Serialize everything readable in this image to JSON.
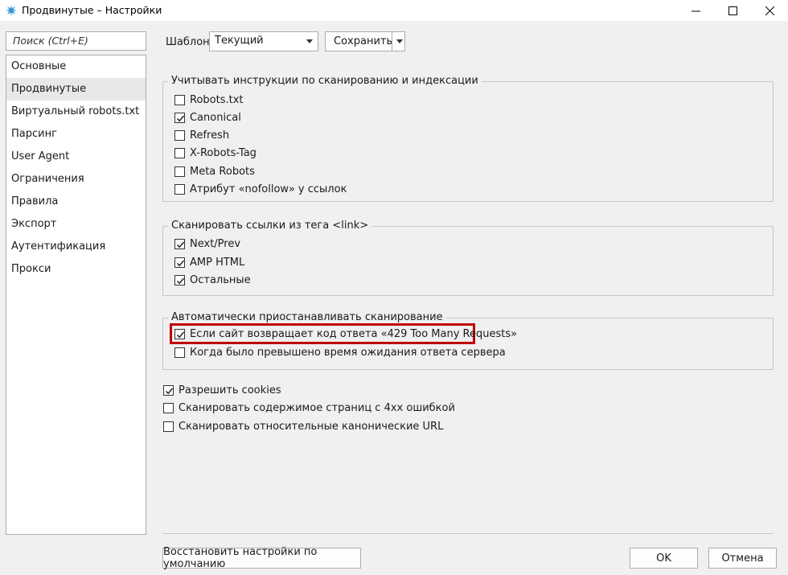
{
  "window": {
    "title": "Продвинутые – Настройки"
  },
  "sidebar": {
    "search_placeholder": "Поиск (Ctrl+E)",
    "items": [
      {
        "label": "Основные",
        "active": false
      },
      {
        "label": "Продвинутые",
        "active": true
      },
      {
        "label": "Виртуальный robots.txt",
        "active": false
      },
      {
        "label": "Парсинг",
        "active": false
      },
      {
        "label": "User Agent",
        "active": false
      },
      {
        "label": "Ограничения",
        "active": false
      },
      {
        "label": "Правила",
        "active": false
      },
      {
        "label": "Экспорт",
        "active": false
      },
      {
        "label": "Аутентификация",
        "active": false
      },
      {
        "label": "Прокси",
        "active": false
      }
    ]
  },
  "toolbar": {
    "template_label": "Шаблон:",
    "template_value": "Текущий",
    "save_label": "Сохранить"
  },
  "groups": {
    "indexing": {
      "title": "Учитывать инструкции по сканированию и индексации",
      "items": [
        {
          "label": "Robots.txt",
          "checked": false
        },
        {
          "label": "Canonical",
          "checked": true
        },
        {
          "label": "Refresh",
          "checked": false
        },
        {
          "label": "X-Robots-Tag",
          "checked": false
        },
        {
          "label": "Meta Robots",
          "checked": false
        },
        {
          "label": "Атрибут «nofollow» у ссылок",
          "checked": false
        }
      ]
    },
    "link_tag": {
      "title": "Сканировать ссылки из тега <link>",
      "items": [
        {
          "label": "Next/Prev",
          "checked": true
        },
        {
          "label": "AMP HTML",
          "checked": true
        },
        {
          "label": "Остальные",
          "checked": true
        }
      ]
    },
    "auto_pause": {
      "title": "Автоматически приостанавливать сканирование",
      "items": [
        {
          "label": "Если сайт возвращает код ответа «429 Too Many Requests»",
          "checked": true
        },
        {
          "label": "Когда было превышено время ожидания ответа сервера",
          "checked": false
        }
      ]
    }
  },
  "options": [
    {
      "label": "Разрешить cookies",
      "checked": true
    },
    {
      "label": "Сканировать содержимое страниц с 4xx ошибкой",
      "checked": false
    },
    {
      "label": "Сканировать относительные канонические URL",
      "checked": false
    }
  ],
  "footer": {
    "restore_label": "Восстановить настройки по умолчанию",
    "ok_label": "OK",
    "cancel_label": "Отмена"
  },
  "colors": {
    "highlight": "#c00000",
    "panel_bg": "#f0f0f0"
  }
}
